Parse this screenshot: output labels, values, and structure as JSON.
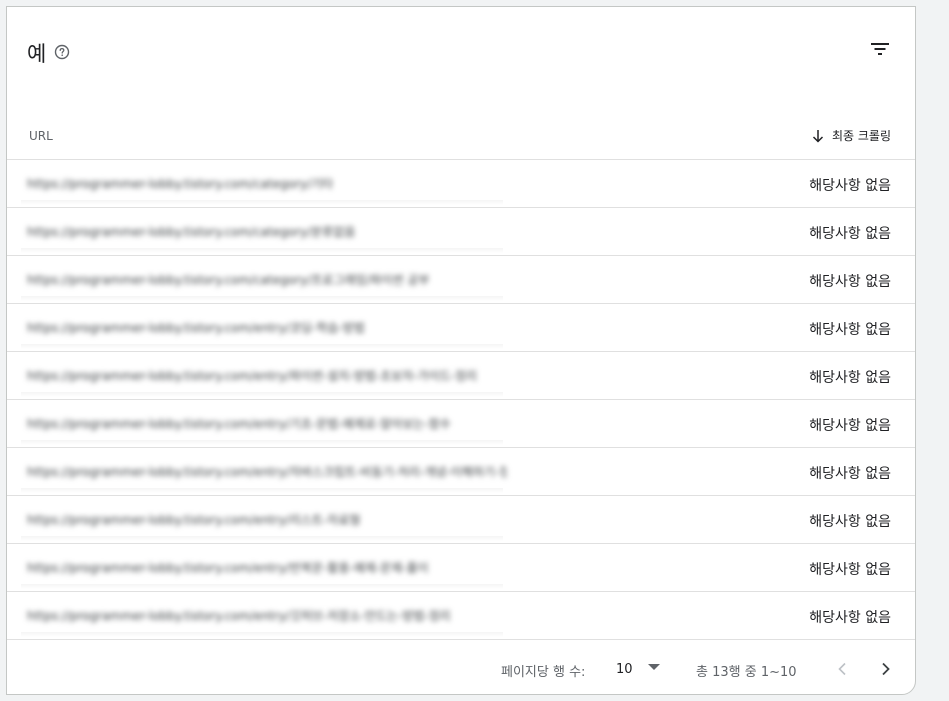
{
  "header": {
    "title": "예",
    "help_icon": "help-circle-icon",
    "filter_icon": "filter-icon"
  },
  "table": {
    "columns": {
      "url": "URL",
      "last_crawl": "최종 크롤링",
      "sort_icon": "arrow-down-icon"
    },
    "rows": [
      {
        "url": "https://programmer-lobby.tistory.com/category/기타",
        "last_crawl": "해당사항 없음"
      },
      {
        "url": "https://programmer-lobby.tistory.com/category/분류없음",
        "last_crawl": "해당사항 없음"
      },
      {
        "url": "https://programmer-lobby.tistory.com/category/프로그래밍/파이썬 공부",
        "last_crawl": "해당사항 없음"
      },
      {
        "url": "https://programmer-lobby.tistory.com/entry/코딩-학습-방법",
        "last_crawl": "해당사항 없음"
      },
      {
        "url": "https://programmer-lobby.tistory.com/entry/파이썬-설치-방법-초보자-가이드-정리",
        "last_crawl": "해당사항 없음"
      },
      {
        "url": "https://programmer-lobby.tistory.com/entry/기초-문법-예제로-알아보는-함수",
        "last_crawl": "해당사항 없음"
      },
      {
        "url": "https://programmer-lobby.tistory.com/entry/자바스크립트-비동기-처리-개념-이해하기-정리",
        "last_crawl": "해당사항 없음"
      },
      {
        "url": "https://programmer-lobby.tistory.com/entry/리스트-자료형",
        "last_crawl": "해당사항 없음"
      },
      {
        "url": "https://programmer-lobby.tistory.com/entry/반복문-활용-예제-문제-풀이",
        "last_crawl": "해당사항 없음"
      },
      {
        "url": "https://programmer-lobby.tistory.com/entry/깃허브-저장소-만드는-방법-정리",
        "last_crawl": "해당사항 없음"
      }
    ]
  },
  "footer": {
    "rows_per_page_label": "페이지당 행 수:",
    "rows_per_page_value": "10",
    "range_text": "총 13행 중 1~10",
    "prev_icon": "chevron-left-icon",
    "next_icon": "chevron-right-icon"
  },
  "colors": {
    "border": "#e0e0e0",
    "text_primary": "#202124",
    "text_secondary": "#5f6368",
    "disabled": "#bdc1c6"
  }
}
